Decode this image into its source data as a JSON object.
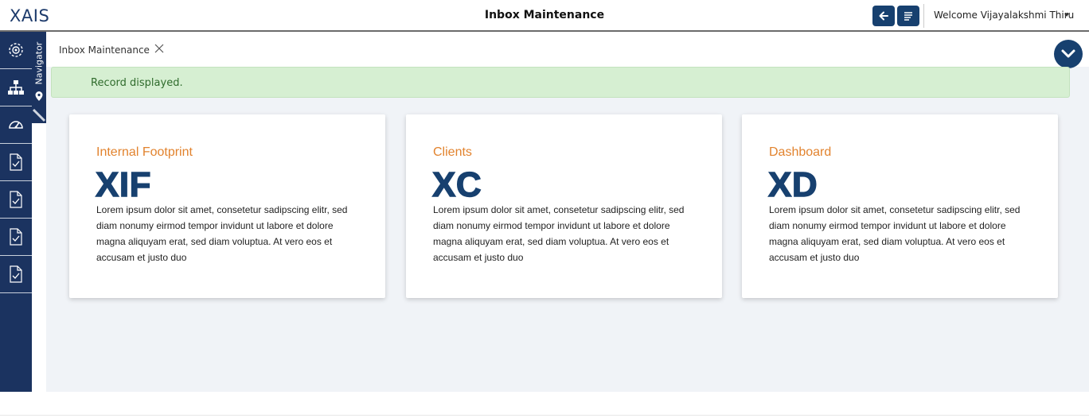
{
  "header": {
    "logo": "XAIS",
    "title": "Inbox Maintenance",
    "welcome": "Welcome Vijayalakshmi Thiru"
  },
  "navigator": {
    "label": "Navigator"
  },
  "tabs": [
    {
      "label": "Inbox Maintenance"
    }
  ],
  "alert": {
    "message": "Record displayed."
  },
  "cards": [
    {
      "title": "Internal Footprint",
      "abbr": "XIF",
      "description": "Lorem ipsum dolor sit amet, consetetur sadipscing elitr, sed diam nonumy eirmod tempor invidunt ut labore et dolore magna aliquyam erat, sed diam voluptua. At vero eos et accusam et justo duo"
    },
    {
      "title": "Clients",
      "abbr": "XC",
      "description": "Lorem ipsum dolor sit amet, consetetur sadipscing elitr, sed diam nonumy eirmod tempor invidunt ut labore et dolore magna aliquyam erat, sed diam voluptua. At vero eos et accusam et justo duo"
    },
    {
      "title": "Dashboard",
      "abbr": "XD",
      "description": "Lorem ipsum dolor sit amet, consetetur sadipscing elitr, sed diam nonumy eirmod tempor invidunt ut labore et dolore magna aliquyam erat, sed diam voluptua. At vero eos et accusam et justo duo"
    }
  ],
  "colors": {
    "brand": "#17406f",
    "sidebar": "#1b3360",
    "accent": "#e2832e",
    "success_bg": "#d6efd2",
    "success_text": "#2f6b2c"
  },
  "icons": {
    "sidebar": [
      "settings-cog-icon",
      "sitemap-icon",
      "speedometer-icon",
      "document-check-icon",
      "document-check-icon",
      "document-check-icon",
      "document-check-icon"
    ],
    "toolbar": [
      "arrow-left-icon",
      "menu-lines-icon"
    ]
  }
}
